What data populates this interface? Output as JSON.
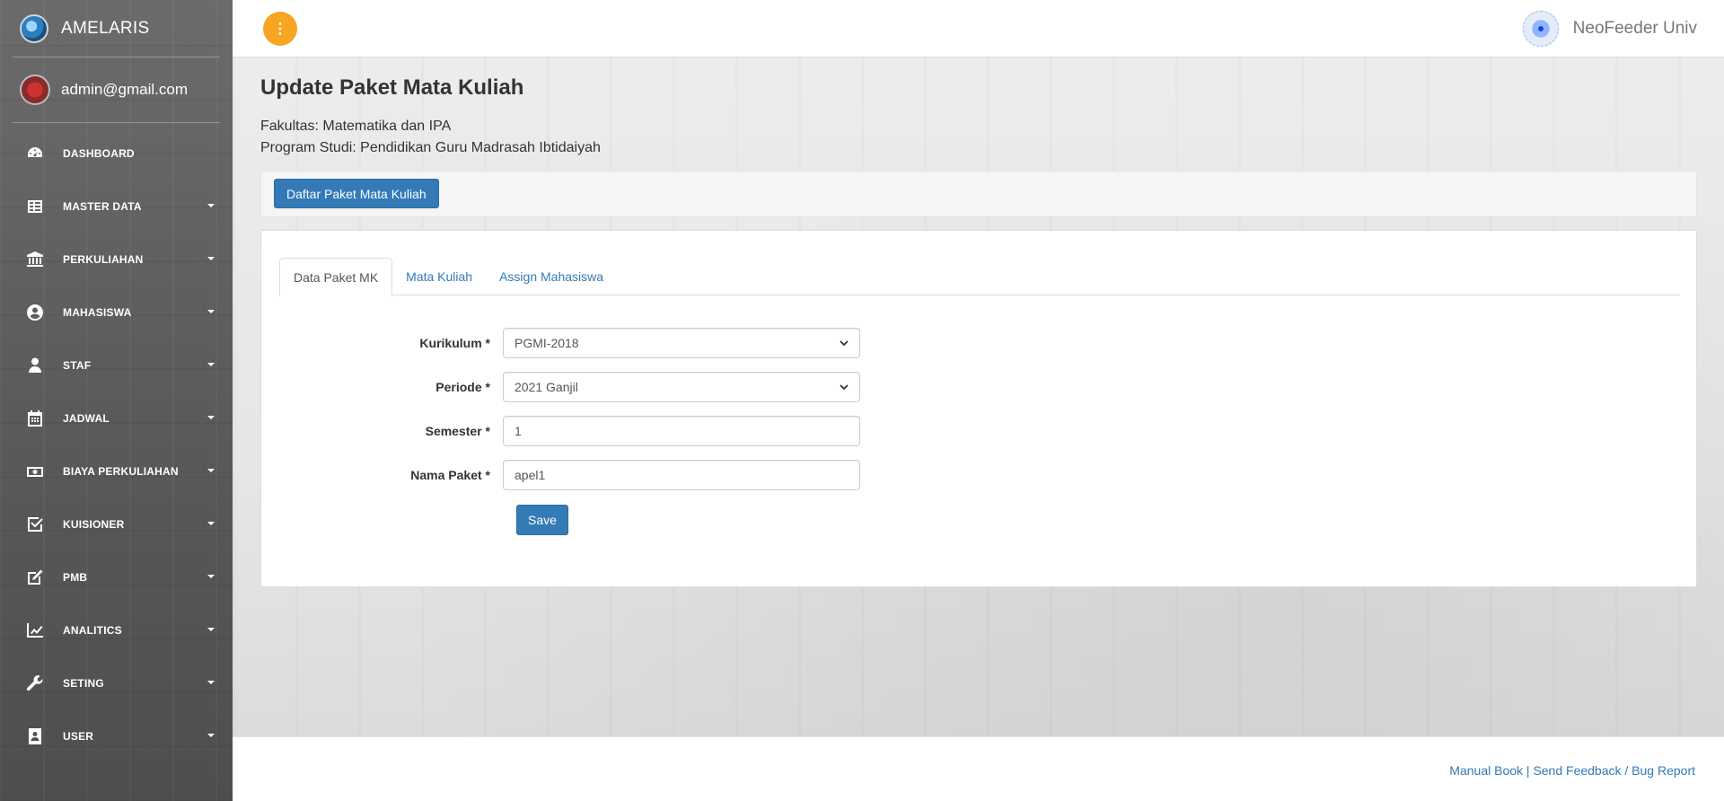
{
  "brand": {
    "name": "AMELARIS"
  },
  "user": {
    "email": "admin@gmail.com"
  },
  "sidebar": {
    "items": [
      {
        "label": "DASHBOARD",
        "icon": "dashboard-icon",
        "has_submenu": false
      },
      {
        "label": "MASTER DATA",
        "icon": "table-icon",
        "has_submenu": true
      },
      {
        "label": "PERKULIAHAN",
        "icon": "university-icon",
        "has_submenu": true
      },
      {
        "label": "MAHASISWA",
        "icon": "user-circle-icon",
        "has_submenu": true
      },
      {
        "label": "STAF",
        "icon": "user-icon",
        "has_submenu": true
      },
      {
        "label": "JADWAL",
        "icon": "calendar-icon",
        "has_submenu": true
      },
      {
        "label": "BIAYA PERKULIAHAN",
        "icon": "money-icon",
        "has_submenu": true
      },
      {
        "label": "KUISIONER",
        "icon": "check-square-icon",
        "has_submenu": true
      },
      {
        "label": "PMB",
        "icon": "edit-icon",
        "has_submenu": true
      },
      {
        "label": "ANALITICS",
        "icon": "line-chart-icon",
        "has_submenu": true
      },
      {
        "label": "SETING",
        "icon": "wrench-icon",
        "has_submenu": true
      },
      {
        "label": "USER",
        "icon": "address-book-icon",
        "has_submenu": true
      }
    ]
  },
  "topbar": {
    "toggle_label": "⋮",
    "right_title": "NeoFeeder Univ"
  },
  "page": {
    "title": "Update Paket Mata Kuliah",
    "fakultas": "Fakultas: Matematika dan IPA",
    "program_studi": "Program Studi: Pendidikan Guru Madrasah Ibtidaiyah",
    "list_button": "Daftar Paket Mata Kuliah"
  },
  "tabs": [
    {
      "label": "Data Paket MK",
      "active": true
    },
    {
      "label": "Mata Kuliah",
      "active": false
    },
    {
      "label": "Assign Mahasiswa",
      "active": false
    }
  ],
  "form": {
    "kurikulum": {
      "label": "Kurikulum *",
      "value": "PGMI-2018"
    },
    "periode": {
      "label": "Periode *",
      "value": "2021 Ganjil"
    },
    "semester": {
      "label": "Semester *",
      "value": "1"
    },
    "nama_paket": {
      "label": "Nama Paket *",
      "value": "apel1"
    },
    "save_label": "Save"
  },
  "footer": {
    "manual_book": "Manual Book",
    "separator": " | ",
    "feedback": "Send Feedback / Bug Report"
  },
  "colors": {
    "primary": "#337ab7",
    "toggle": "#f6a623",
    "sidebar": "#5e5e5e"
  }
}
